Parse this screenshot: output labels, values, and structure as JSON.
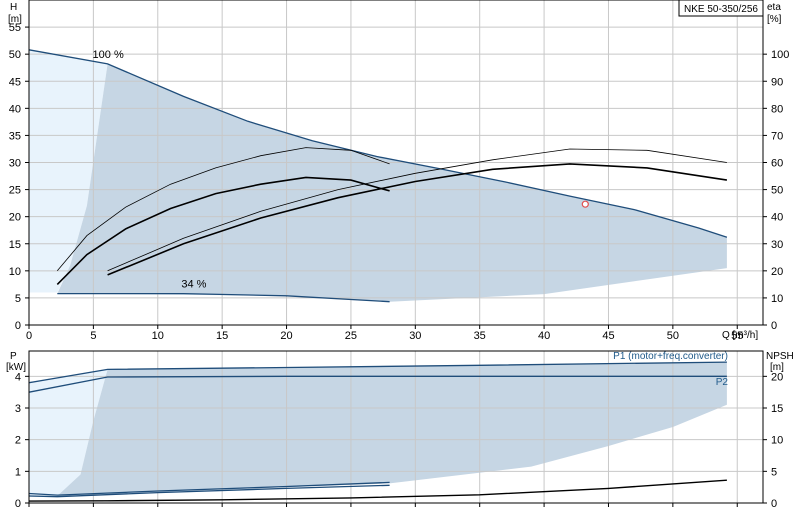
{
  "chart_data": [
    {
      "type": "line",
      "model_label": "NKE 50-350/256",
      "x_axis": {
        "label": "Q [m³/h]",
        "range": [
          0,
          57
        ],
        "ticks": [
          0,
          5,
          10,
          15,
          20,
          25,
          30,
          35,
          40,
          45,
          50,
          55
        ]
      },
      "y_left": {
        "label_top": "H",
        "label_unit": "[m]",
        "range": [
          0,
          60
        ],
        "ticks": [
          0,
          5,
          10,
          15,
          20,
          25,
          30,
          35,
          40,
          45,
          50,
          55
        ]
      },
      "y_right": {
        "label_top": "eta",
        "label_unit": "[%]",
        "range": [
          0,
          120
        ],
        "ticks": [
          0,
          10,
          20,
          30,
          40,
          50,
          60,
          70,
          80,
          90,
          100
        ]
      },
      "grid": true,
      "speed_labels": [
        {
          "text": "100 %",
          "x": 6.1,
          "y": 49.5
        },
        {
          "text": "34 %",
          "x": 13,
          "y": 7.1
        }
      ],
      "series": [
        {
          "role": "head_max",
          "axis": "left",
          "x": [
            0,
            6.1,
            12,
            17,
            22,
            27,
            32,
            37,
            42,
            47,
            52,
            54.2
          ],
          "y": [
            50.8,
            48.2,
            42.2,
            37.6,
            34,
            31.1,
            28.8,
            26.4,
            23.8,
            21.3,
            17.9,
            16.2
          ]
        },
        {
          "role": "head_min",
          "axis": "left",
          "x": [
            2.2,
            12,
            20,
            28
          ],
          "y": [
            5.8,
            5.8,
            5.4,
            4.3
          ]
        },
        {
          "role": "eta_thin_a",
          "axis": "right",
          "x": [
            2.2,
            4.5,
            7.5,
            11,
            14.5,
            18,
            21.5,
            25,
            28
          ],
          "y": [
            20,
            33,
            43.5,
            52,
            58,
            62.5,
            65.5,
            64.5,
            59.5
          ]
        },
        {
          "role": "eta_thick_a",
          "axis": "right",
          "x": [
            2.2,
            4.5,
            7.5,
            11,
            14.5,
            18,
            21.5,
            25,
            28
          ],
          "y": [
            15,
            26,
            35.5,
            43,
            48.5,
            52,
            54.5,
            53.5,
            49.5
          ]
        },
        {
          "role": "eta_thin_b",
          "axis": "right",
          "x": [
            6.1,
            12,
            18,
            24,
            30,
            36,
            42,
            48,
            54.2
          ],
          "y": [
            20,
            32,
            42,
            50,
            56,
            61,
            65,
            64.5,
            60
          ]
        },
        {
          "role": "eta_thick_b",
          "axis": "right",
          "x": [
            6.1,
            12,
            18,
            24,
            30,
            36,
            42,
            48,
            54.2
          ],
          "y": [
            18.5,
            30,
            39.5,
            47,
            53,
            57.5,
            59.5,
            58,
            53.5
          ]
        }
      ],
      "operating_point": {
        "x": 43.2,
        "y": 22.3
      }
    },
    {
      "type": "line",
      "x_axis": {
        "range": [
          0,
          57
        ],
        "ticks": [
          0,
          5,
          10,
          15,
          20,
          25,
          30,
          35,
          40,
          45,
          50,
          55
        ]
      },
      "y_left": {
        "label_top": "P",
        "label_unit": "[kW]",
        "range": [
          0,
          4.8
        ],
        "ticks": [
          0,
          1,
          2,
          3,
          4
        ]
      },
      "y_right": {
        "label_top": "NPSH",
        "label_unit": "[m]",
        "range": [
          0,
          24
        ],
        "ticks": [
          0,
          5,
          10,
          15,
          20
        ]
      },
      "grid": true,
      "series_labels": [
        {
          "text": "P1 (motor+freq.converter)",
          "x": 54.2,
          "y": 4.55
        },
        {
          "text": "P2",
          "x": 54.2,
          "y": 3.73
        }
      ],
      "series": [
        {
          "role": "P1_max",
          "axis": "left",
          "x": [
            0,
            6.1,
            20,
            35,
            54.2
          ],
          "y": [
            3.8,
            4.22,
            4.28,
            4.35,
            4.45
          ]
        },
        {
          "role": "P2_max",
          "axis": "left",
          "x": [
            0,
            6.1,
            20,
            35,
            54.2
          ],
          "y": [
            3.5,
            3.98,
            4.0,
            4.0,
            4.0
          ]
        },
        {
          "role": "P1_min",
          "axis": "left",
          "x": [
            0,
            2.2,
            10,
            20,
            28
          ],
          "y": [
            0.3,
            0.25,
            0.38,
            0.52,
            0.65
          ]
        },
        {
          "role": "P2_min",
          "axis": "left",
          "x": [
            0,
            2.2,
            10,
            20,
            28
          ],
          "y": [
            0.22,
            0.2,
            0.33,
            0.46,
            0.56
          ]
        },
        {
          "role": "npsh",
          "axis": "right",
          "x": [
            0,
            6.1,
            15,
            25,
            35,
            45,
            54.2
          ],
          "y": [
            0.3,
            0.35,
            0.5,
            0.8,
            1.3,
            2.3,
            3.6
          ]
        }
      ]
    }
  ]
}
